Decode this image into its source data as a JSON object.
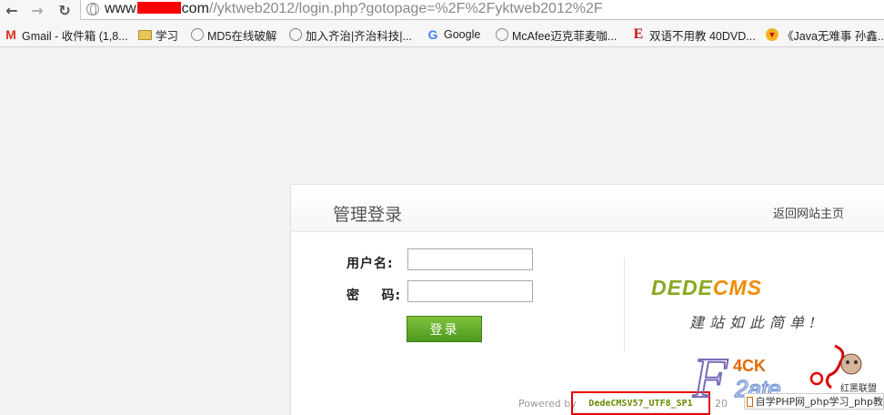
{
  "browser": {
    "url_host_start": "www",
    "url_host_end": "com",
    "url_path": "//yktweb2012/login.php?gotopage=%2F%2Fyktweb2012%2F",
    "bookmarks": [
      {
        "label": "Gmail - 收件箱 (1,8...",
        "icon": "gmail-icon"
      },
      {
        "label": "学习",
        "icon": "folder-icon"
      },
      {
        "label": "MD5在线破解",
        "icon": "globe-icon"
      },
      {
        "label": "加入齐治|齐治科技|...",
        "icon": "globe-icon"
      },
      {
        "label": "Google",
        "icon": "google-icon"
      },
      {
        "label": "McAfee迈克菲麦咖...",
        "icon": "globe-icon"
      },
      {
        "label": "双语不用教 40DVD...",
        "icon": "e-icon"
      },
      {
        "label": "《Java无难事 孙鑫...",
        "icon": "badge-icon"
      }
    ]
  },
  "login": {
    "title": "管理登录",
    "home_link": "返回网站主页",
    "username_label": "用户名:",
    "password_label": "密    码:",
    "username_value": "",
    "password_value": "",
    "submit_label": "登录"
  },
  "brand": {
    "name_main": "DEDE",
    "name_accent": "CMS",
    "slogan": "建站如此简单!"
  },
  "footer": {
    "powered_prefix": "Powered by",
    "version": "DedeCMSV57_UTF8_SP1",
    "copy_fragment": "20"
  },
  "watermark": {
    "tag": "红黑联盟",
    "ribbon": "自学PHP网_php学习_php教"
  },
  "colors": {
    "button_green": "#5aa625",
    "brand_green": "#8aa820",
    "brand_orange": "#f08c00",
    "highlight_red": "#e60000"
  }
}
